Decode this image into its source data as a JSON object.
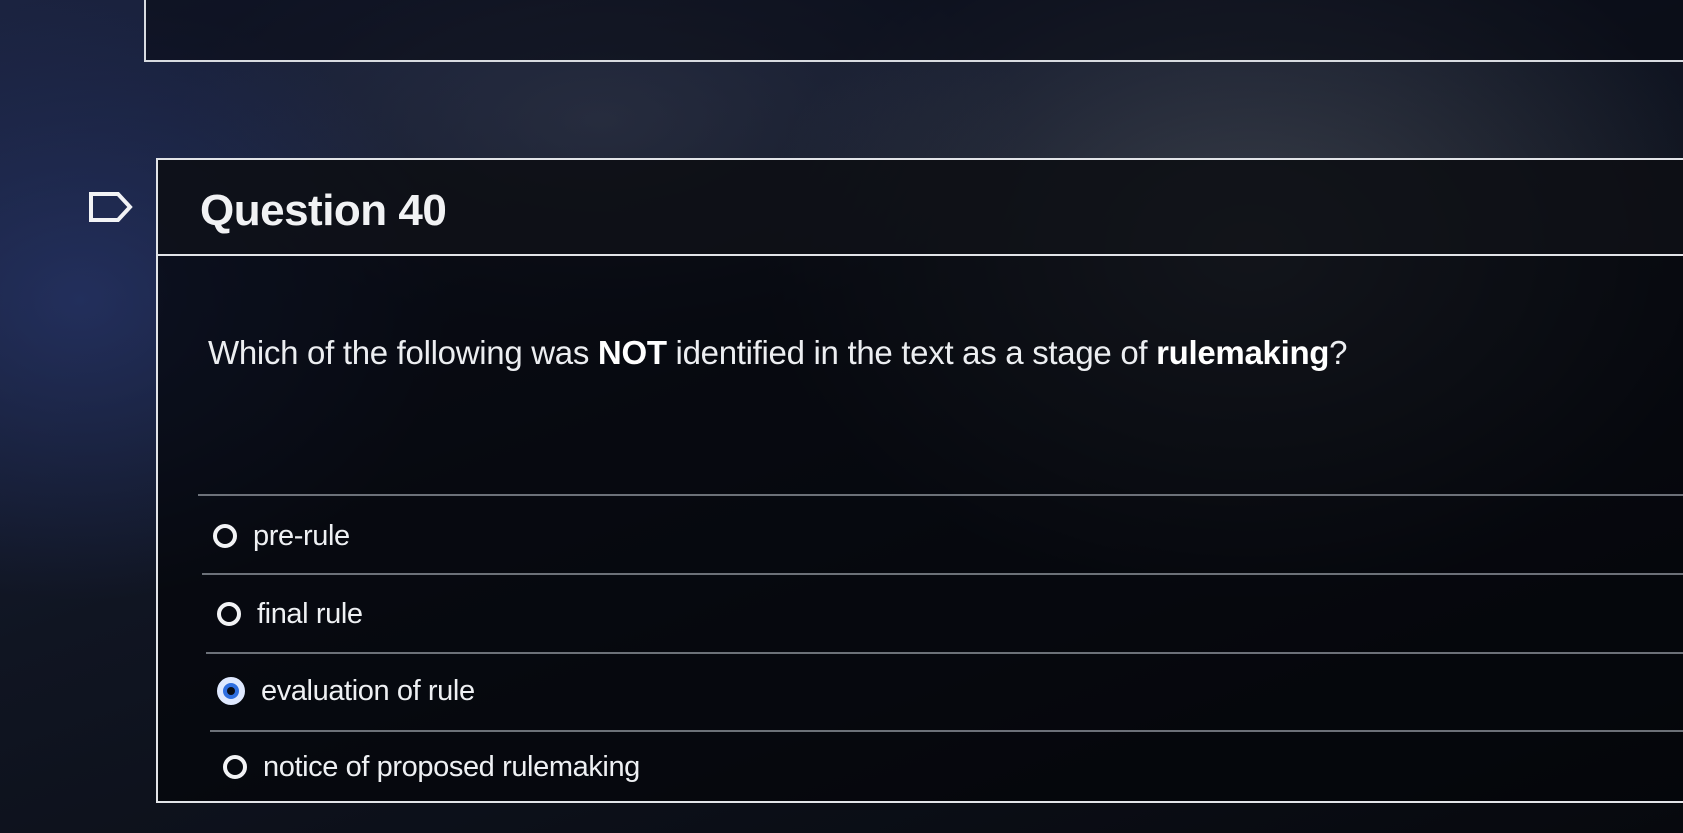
{
  "question": {
    "title": "Question 40",
    "prompt": {
      "part1": "Which of the following was ",
      "emphasis1": "NOT",
      "part2": " identified in the text as a stage of ",
      "emphasis2": "rulemaking",
      "part3": "?"
    },
    "answers": [
      {
        "label": "pre-rule",
        "selected": false
      },
      {
        "label": "final rule",
        "selected": false
      },
      {
        "label": "evaluation of rule",
        "selected": true
      },
      {
        "label": "notice of proposed rulemaking",
        "selected": false
      }
    ]
  },
  "icons": {
    "flag": "flag-outline-icon",
    "unselected": "radio-empty-icon",
    "selected": "radio-checked-icon"
  },
  "colors": {
    "selected_radio": "#2f6fe0",
    "panel_border": "#e2e4e8",
    "text": "#eceef1"
  }
}
